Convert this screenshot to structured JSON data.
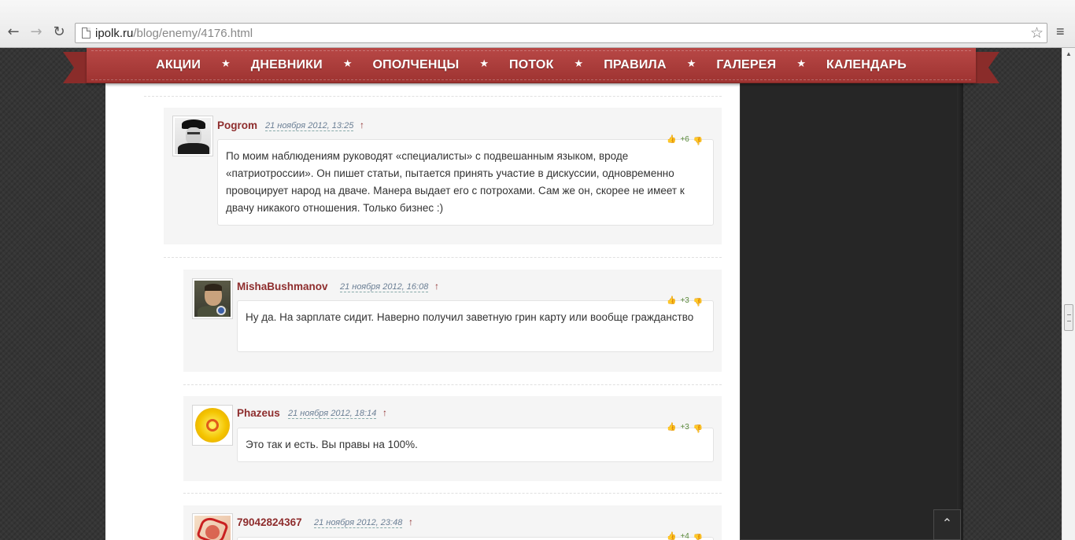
{
  "browser": {
    "url_host": "ipolk.ru",
    "url_path": "/blog/enemy/4176.html",
    "back_icon": "←",
    "forward_icon": "→",
    "reload_icon": "↻",
    "star_icon": "☆",
    "menu_icon": "≡"
  },
  "menu": {
    "items": [
      "АКЦИИ",
      "ДНЕВНИКИ",
      "ОПОЛЧЕНЦЫ",
      "ПОТОК",
      "ПРАВИЛА",
      "ГАЛЕРЕЯ",
      "КАЛЕНДАРЬ"
    ],
    "separator": "★"
  },
  "comments": [
    {
      "author": "Pogrom",
      "date": "21 ноября 2012, 13:25",
      "parent_link": "↑",
      "score": "+6",
      "text": "По моим наблюдениям руководят «специалисты» с подвешанным языком, вроде «патриотроссии». Он пишет статьи, пытается принять участие в дискуссии, одновременно провоцирует народ на дваче. Манера  выдает его  с потрохами. Сам же он, скорее не имеет  к двачу никакого отношения. Только бизнес :)"
    },
    {
      "author": "MishaBushmanov",
      "date": "21 ноября 2012, 16:08",
      "parent_link": "↑",
      "score": "+3",
      "text": "Ну да. На зарплате сидит. Наверно получил заветную грин карту или вообще гражданство"
    },
    {
      "author": "Phazeus",
      "date": "21 ноября 2012, 18:14",
      "parent_link": "↑",
      "score": "+3",
      "text": "Это так и есть. Вы правы на 100%."
    },
    {
      "author": "79042824367",
      "date": "21 ноября 2012, 23:48",
      "parent_link": "↑",
      "score": "+4",
      "text": ""
    }
  ],
  "vote": {
    "up_icon": "👍",
    "down_icon": "👎"
  },
  "to_top_icon": "⌃"
}
